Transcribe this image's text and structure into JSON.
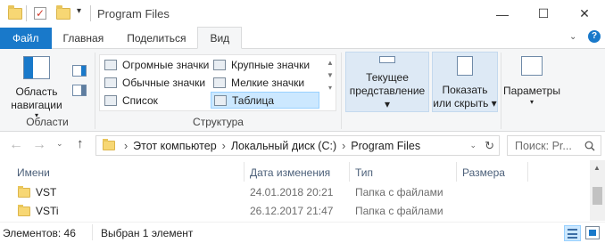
{
  "titlebar": {
    "title": "Program Files",
    "minimize": "—",
    "maximize": "☐",
    "close": "✕"
  },
  "tabs": {
    "file": "Файл",
    "home": "Главная",
    "share": "Поделиться",
    "view": "Вид"
  },
  "ribbon": {
    "panes": {
      "nav_pane_line1": "Область",
      "nav_pane_line2": "навигации",
      "group": "Области"
    },
    "layout": {
      "items": [
        "Огромные значки",
        "Крупные значки",
        "Обычные значки",
        "Мелкие значки",
        "Список",
        "Таблица"
      ],
      "selected": "Таблица",
      "group": "Структура"
    },
    "current_view": {
      "line1": "Текущее",
      "line2": "представление"
    },
    "show_hide": {
      "line1": "Показать",
      "line2": "или скрыть"
    },
    "options": {
      "label": "Параметры"
    }
  },
  "address": {
    "crumbs": [
      "Этот компьютер",
      "Локальный диск (C:)",
      "Program Files"
    ],
    "search_placeholder": "Поиск: Pr..."
  },
  "list": {
    "columns": [
      "Имени",
      "Дата изменения",
      "Тип",
      "Размера"
    ],
    "rows": [
      {
        "name": "VST",
        "date": "24.01.2018 20:21",
        "type": "Папка с файлами",
        "size": ""
      },
      {
        "name": "VSTi",
        "date": "26.12.2017 21:47",
        "type": "Папка с файлами",
        "size": ""
      }
    ]
  },
  "status": {
    "count": "Элементов: 46",
    "selected": "Выбран 1 элемент"
  },
  "colors": {
    "accent": "#1979ca",
    "selection": "#cce8ff"
  }
}
